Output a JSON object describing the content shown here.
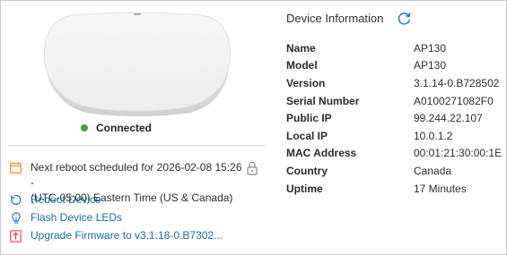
{
  "device": {
    "status": "Connected",
    "status_color": "#3ea340"
  },
  "actions": {
    "reboot_schedule_line1": "Next reboot scheduled for 2026-02-08 15:26 -",
    "reboot_schedule_line2": "(UTC-05:00) Eastern Time (US & Canada)",
    "reboot_device": "Reboot Device",
    "flash_leds": "Flash Device LEDs",
    "upgrade_firmware": "Upgrade Firmware to v3.1.18-0.B7302...",
    "link_color": "#1b6da3",
    "icons": [
      "calendar-icon",
      "lock-icon",
      "reboot-icon",
      "bulb-icon",
      "upload-icon"
    ]
  },
  "info": {
    "title": "Device Information",
    "rows": [
      {
        "label": "Name",
        "value": "AP130"
      },
      {
        "label": "Model",
        "value": "AP130"
      },
      {
        "label": "Version",
        "value": "3.1.14-0.B728502"
      },
      {
        "label": "Serial Number",
        "value": "A0100271082F0"
      },
      {
        "label": "Public IP",
        "value": "99.244.22.107"
      },
      {
        "label": "Local IP",
        "value": "10.0.1.2"
      },
      {
        "label": "MAC Address",
        "value": "00:01:21:30:00:1E"
      },
      {
        "label": "Country",
        "value": "Canada"
      },
      {
        "label": "Uptime",
        "value": "17 Minutes"
      }
    ]
  }
}
